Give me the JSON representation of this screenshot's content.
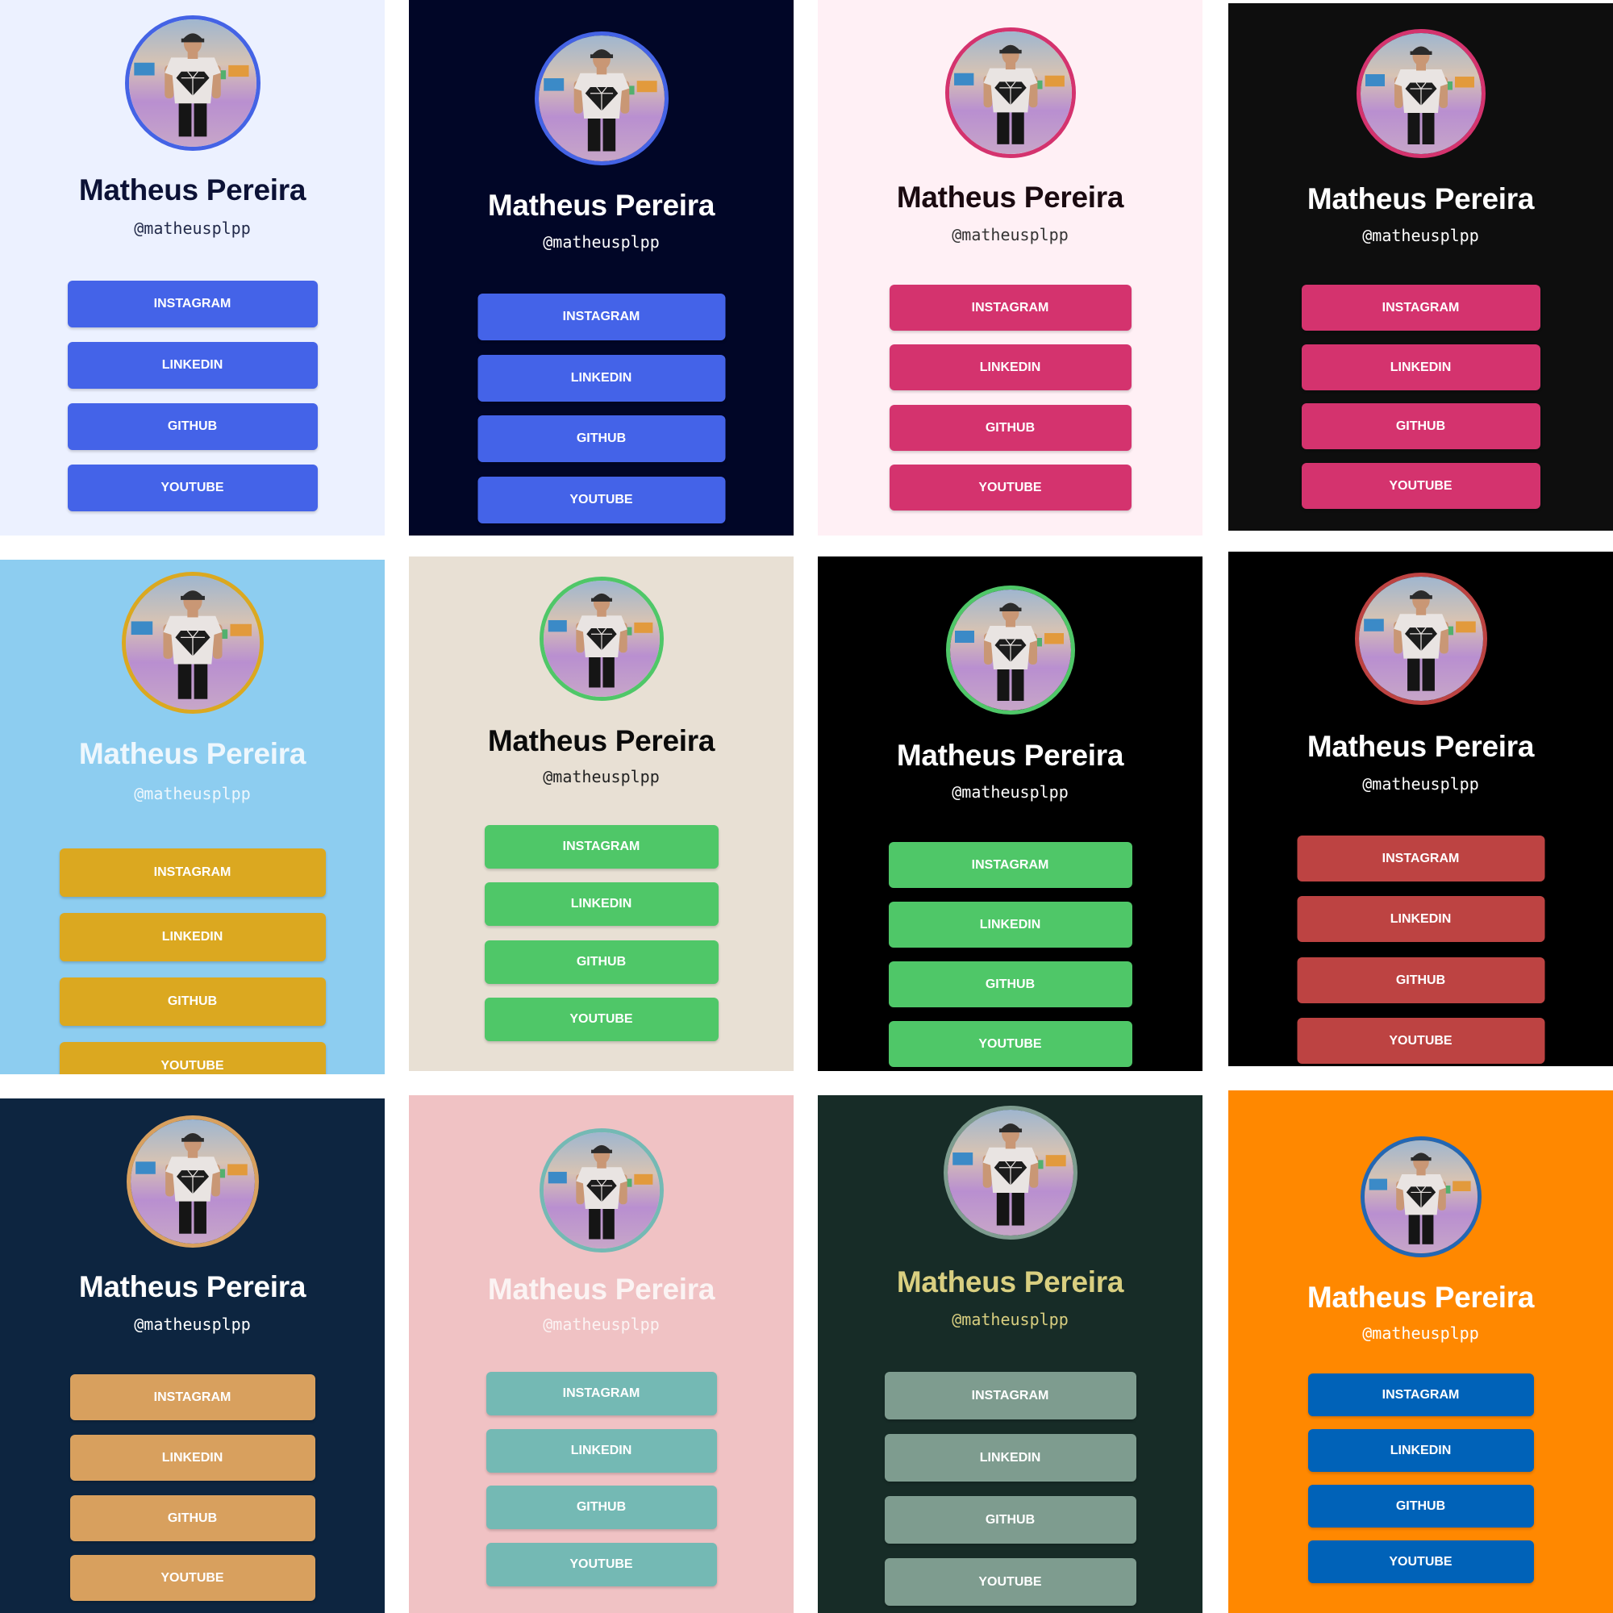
{
  "profile": {
    "name": "Matheus Pereira",
    "handle": "@matheusplpp",
    "links": [
      "INSTAGRAM",
      "LINKEDIN",
      "GITHUB",
      "YOUTUBE"
    ]
  },
  "themes": [
    {
      "bg": "#ecf1ff",
      "ring": "#4463e5",
      "name": "#0c1236",
      "handle": "#222a4a",
      "button": "#4463e8"
    },
    {
      "bg": "#010627",
      "ring": "#4463e5",
      "name": "#ffffff",
      "handle": "#ffffff",
      "button": "#4463e8"
    },
    {
      "bg": "#fff0f5",
      "ring": "#d4336e",
      "name": "#1a0a10",
      "handle": "#333333",
      "button": "#d4336e"
    },
    {
      "bg": "#0e0e0e",
      "ring": "#d4336e",
      "name": "#ffffff",
      "handle": "#ffffff",
      "button": "#d4336e"
    },
    {
      "bg": "#8dcdf0",
      "ring": "#dba820",
      "name": "#eef7fd",
      "handle": "#eef7fd",
      "button": "#dba820"
    },
    {
      "bg": "#e8e0d4",
      "ring": "#4fc768",
      "name": "#0b0b0b",
      "handle": "#222222",
      "button": "#4fc768"
    },
    {
      "bg": "#000000",
      "ring": "#4fc768",
      "name": "#ffffff",
      "handle": "#ffffff",
      "button": "#4fc768"
    },
    {
      "bg": "#000000",
      "ring": "#bd4342",
      "name": "#ffffff",
      "handle": "#ffffff",
      "button": "#bd4342"
    },
    {
      "bg": "#0d2540",
      "ring": "#d8a05e",
      "name": "#ffffff",
      "handle": "#ffffff",
      "button": "#d8a05e"
    },
    {
      "bg": "#f0c2c4",
      "ring": "#74b9b4",
      "name": "#fbf3f3",
      "handle": "#fbf3f3",
      "button": "#74b9b4"
    },
    {
      "bg": "#172c27",
      "ring": "#7e9c8f",
      "name": "#d9cf80",
      "handle": "#d9cf80",
      "button": "#7e9c8f"
    },
    {
      "bg": "#ff8800",
      "ring": "#2367b4",
      "name": "#ffffff",
      "handle": "#ffffff",
      "button": "#0062b8"
    }
  ]
}
